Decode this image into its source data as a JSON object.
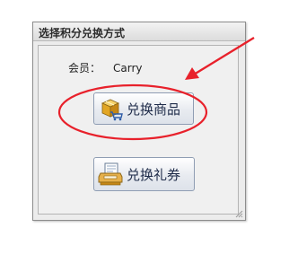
{
  "window": {
    "title": "选择积分兑换方式"
  },
  "member": {
    "label": "会员：",
    "name": "Carry"
  },
  "buttons": {
    "exchange_goods": {
      "label": "兑换商品",
      "icon": "package-cart-icon"
    },
    "exchange_coupon": {
      "label": "兑换礼券",
      "icon": "voucher-printer-icon"
    }
  },
  "annotation": {
    "color": "#e8212b"
  }
}
